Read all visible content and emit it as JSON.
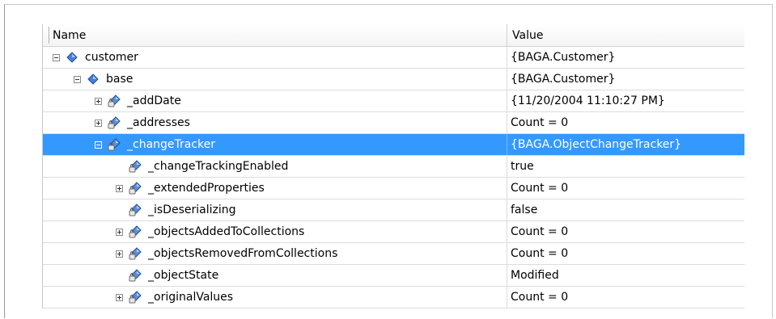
{
  "header": {
    "name_label": "Name",
    "value_label": "Value"
  },
  "rows": [
    {
      "name": "customer",
      "value": "{BAGA.Customer}",
      "level": 0,
      "expander": "minus",
      "icon": "object-diamond-icon"
    },
    {
      "name": "base",
      "value": "{BAGA.Customer}",
      "level": 1,
      "expander": "minus",
      "icon": "object-diamond-icon"
    },
    {
      "name": "_addDate",
      "value": "{11/20/2004 11:10:27 PM}",
      "level": 2,
      "expander": "plus",
      "icon": "private-field-icon"
    },
    {
      "name": "_addresses",
      "value": "Count = 0",
      "level": 2,
      "expander": "plus",
      "icon": "private-field-icon"
    },
    {
      "name": "_changeTracker",
      "value": "{BAGA.ObjectChangeTracker}",
      "level": 2,
      "expander": "minus",
      "icon": "private-field-icon",
      "selected": true
    },
    {
      "name": "_changeTrackingEnabled",
      "value": "true",
      "level": 3,
      "expander": "none",
      "icon": "private-field-icon"
    },
    {
      "name": "_extendedProperties",
      "value": "Count = 0",
      "level": 3,
      "expander": "plus",
      "icon": "private-field-icon"
    },
    {
      "name": "_isDeserializing",
      "value": "false",
      "level": 3,
      "expander": "none",
      "icon": "private-field-icon"
    },
    {
      "name": "_objectsAddedToCollections",
      "value": "Count = 0",
      "level": 3,
      "expander": "plus",
      "icon": "private-field-icon"
    },
    {
      "name": "_objectsRemovedFromCollections",
      "value": "Count = 0",
      "level": 3,
      "expander": "plus",
      "icon": "private-field-icon"
    },
    {
      "name": "_objectState",
      "value": "Modified",
      "level": 3,
      "expander": "none",
      "icon": "private-field-icon"
    },
    {
      "name": "_originalValues",
      "value": "Count = 0",
      "level": 3,
      "expander": "plus",
      "icon": "private-field-icon"
    }
  ]
}
